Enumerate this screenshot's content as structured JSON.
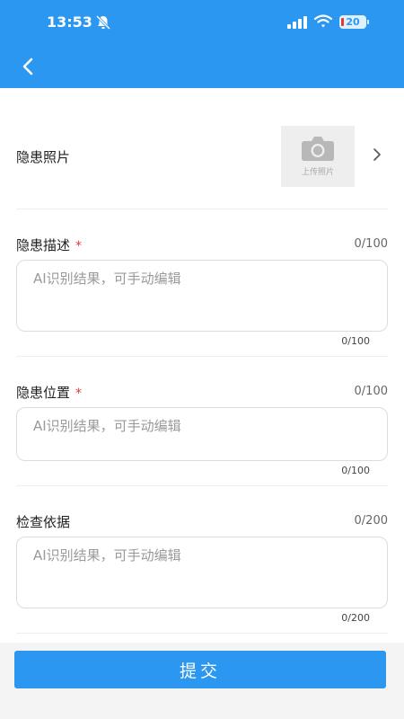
{
  "status_bar": {
    "time": "13:53",
    "battery": "20"
  },
  "header": {
    "back_icon": "chevron-left-icon"
  },
  "photo": {
    "label": "隐患照片",
    "upload_text": "上传照片",
    "icon": "camera-icon"
  },
  "fields": [
    {
      "label": "隐患描述",
      "required": "*",
      "count_top": "0/100",
      "placeholder": "AI识别结果，可手动编辑",
      "count_bottom": "0/100"
    },
    {
      "label": "隐患位置",
      "required": "*",
      "count_top": "0/100",
      "placeholder": "AI识别结果，可手动编辑",
      "count_bottom": "0/100"
    },
    {
      "label": "检查依据",
      "count_top": "0/200",
      "placeholder": "AI识别结果，可手动编辑",
      "count_bottom": "0/200"
    }
  ],
  "submit": {
    "label": "提交"
  },
  "colors": {
    "primary": "#2b97f0",
    "required": "#e53935",
    "background": "#ffffff"
  }
}
